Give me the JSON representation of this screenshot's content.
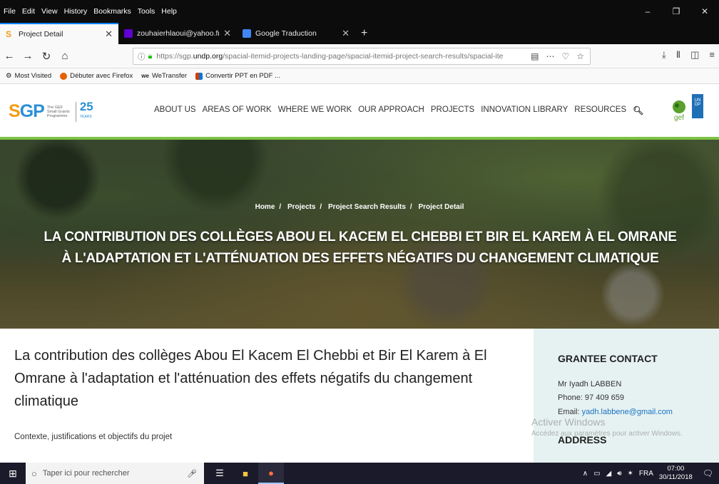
{
  "browser": {
    "menu": [
      "File",
      "Edit",
      "View",
      "History",
      "Bookmarks",
      "Tools",
      "Help"
    ],
    "window_controls": [
      "–",
      "❐",
      "✕"
    ],
    "tabs": [
      {
        "title": "Project Detail",
        "favicon_color": "#f39c12",
        "favicon_char": "S",
        "active": true
      },
      {
        "title": "zouhaierhlaoui@yahoo.fr - Yah",
        "favicon_color": "#5f01d1",
        "active": false
      },
      {
        "title": "Google Traduction",
        "favicon_color": "#4285f4",
        "active": false
      }
    ],
    "new_tab": "+",
    "url_prefix": "https://sgp.",
    "url_domain": "undp.org",
    "url_rest": "/spacial-itemid-projects-landing-page/spacial-itemid-project-search-results/spacial-ite",
    "bookmarks": [
      {
        "label": "Most Visited",
        "color": "#666"
      },
      {
        "label": "Débuter avec Firefox",
        "color": "#e66000"
      },
      {
        "label": "WeTransfer",
        "color": "#222"
      },
      {
        "label": "Convertir PPT en PDF ...",
        "color": "#d83b01"
      }
    ]
  },
  "site": {
    "logo": {
      "letters_s": "S",
      "letters_gp": "GP",
      "tagline": "The GEF Small Grants Programme",
      "anniversary": "25",
      "anniversary_sub": "YEARS"
    },
    "nav": [
      "ABOUT US",
      "AREAS OF WORK",
      "WHERE WE WORK",
      "OUR APPROACH",
      "PROJECTS",
      "INNOVATION LIBRARY",
      "RESOURCES"
    ],
    "partner_logos": {
      "gef": "gef",
      "undp": "UN DP"
    }
  },
  "hero": {
    "breadcrumb": [
      "Home",
      "Projects",
      "Project Search Results",
      "Project Detail"
    ],
    "separator": "/",
    "title": "LA CONTRIBUTION DES COLLÈGES ABOU EL KACEM EL CHEBBI ET BIR EL KAREM À EL OMRANE À L'ADAPTATION ET L'ATTÉNUATION DES EFFETS NÉGATIFS DU CHANGEMENT CLIMATIQUE"
  },
  "content": {
    "heading": "La contribution des collèges Abou El Kacem El Chebbi et Bir El Karem à El Omrane à l'adaptation et l'atténuation des effets négatifs du changement climatique",
    "subheading": "Contexte, justifications et objectifs du projet"
  },
  "sidebar": {
    "grantee_title": "GRANTEE CONTACT",
    "name": "Mr Iyadh LABBEN",
    "phone": "Phone: 97 409 659",
    "email_label": "Email: ",
    "email": "yadh.labbene@gmail.com",
    "address_title": "ADDRESS"
  },
  "watermark": {
    "line1": "Activer Windows",
    "line2": "Accédez aux paramètres pour activer Windows."
  },
  "taskbar": {
    "search_placeholder": "Taper ici pour rechercher",
    "language": "FRA",
    "time": "07:00",
    "date": "30/11/2018"
  }
}
